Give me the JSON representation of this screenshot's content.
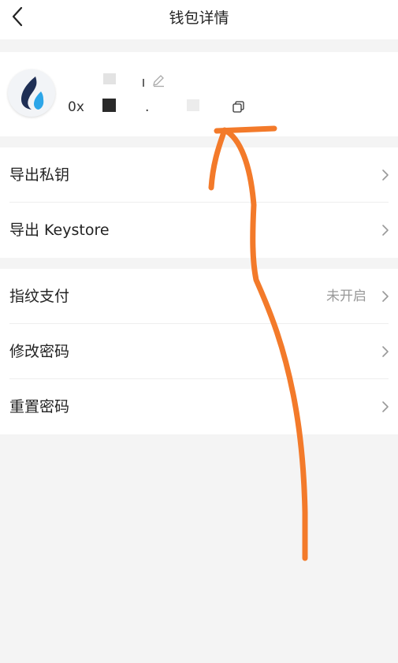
{
  "header": {
    "title": "钱包详情"
  },
  "wallet": {
    "address_prefix": "0x",
    "address_separator": "."
  },
  "group1": {
    "items": [
      {
        "label": "导出私钥"
      },
      {
        "label": "导出 Keystore"
      }
    ]
  },
  "group2": {
    "items": [
      {
        "label": "指纹支付",
        "value": "未开启"
      },
      {
        "label": "修改密码"
      },
      {
        "label": "重置密码"
      }
    ]
  },
  "colors": {
    "annotation_stroke": "#f37a2a",
    "flame_dark": "#1f2f55",
    "flame_light": "#2da6e8"
  },
  "icons": [
    "back-arrow-icon",
    "wallet-flame-icon",
    "edit-icon",
    "copy-icon",
    "chevron-right-icon"
  ]
}
